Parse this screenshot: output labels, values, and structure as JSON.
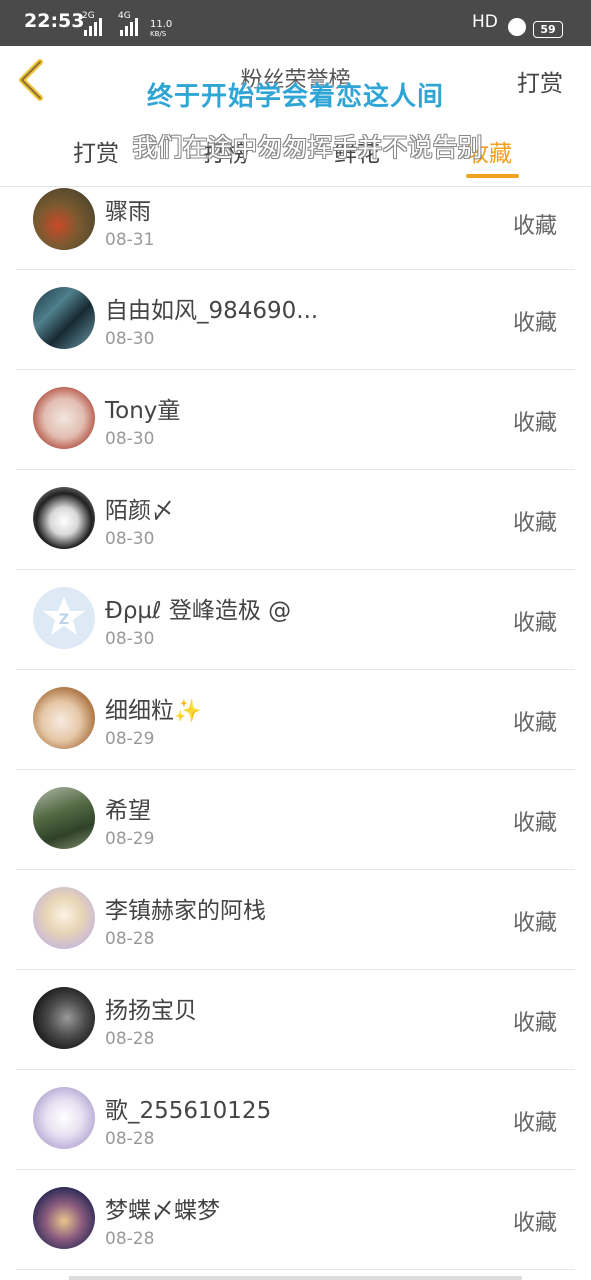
{
  "status_bar": {
    "time": "22:53",
    "signal1_label": "2G",
    "signal2_label": "4G",
    "speed": "11.0",
    "speed_unit": "KB/S",
    "hd": "HD",
    "battery": "59"
  },
  "header": {
    "title": "粉丝荣誉榜",
    "right_button": "打赏",
    "ticker_top": "终于开始学会着恋这人间"
  },
  "tabs": {
    "items": [
      "打赏",
      "打榜",
      "鲜花",
      "收藏"
    ],
    "active_index": 3,
    "active_color": "#f0a020",
    "ticker_bottom": "我们在途中匆匆挥手并不说告别"
  },
  "list": [
    {
      "name": "骤雨",
      "date": "08-31",
      "type": "收藏"
    },
    {
      "name": "自由如风_984690...",
      "date": "08-30",
      "type": "收藏"
    },
    {
      "name": "Tony童",
      "date": "08-30",
      "type": "收藏"
    },
    {
      "name": "陌颜〆",
      "date": "08-30",
      "type": "收藏"
    },
    {
      "name": "Ɖρµℓ 登峰造极 @",
      "date": "08-30",
      "type": "收藏"
    },
    {
      "name": "细细粒",
      "date": "08-29",
      "type": "收藏"
    },
    {
      "name": "希望",
      "date": "08-29",
      "type": "收藏"
    },
    {
      "name": "李镇赫家的阿栈",
      "date": "08-28",
      "type": "收藏"
    },
    {
      "name": "扬扬宝贝",
      "date": "08-28",
      "type": "收藏"
    },
    {
      "name": "歌_255610125",
      "date": "08-28",
      "type": "收藏"
    },
    {
      "name": "梦蝶〆蝶梦",
      "date": "08-28",
      "type": "收藏"
    }
  ]
}
